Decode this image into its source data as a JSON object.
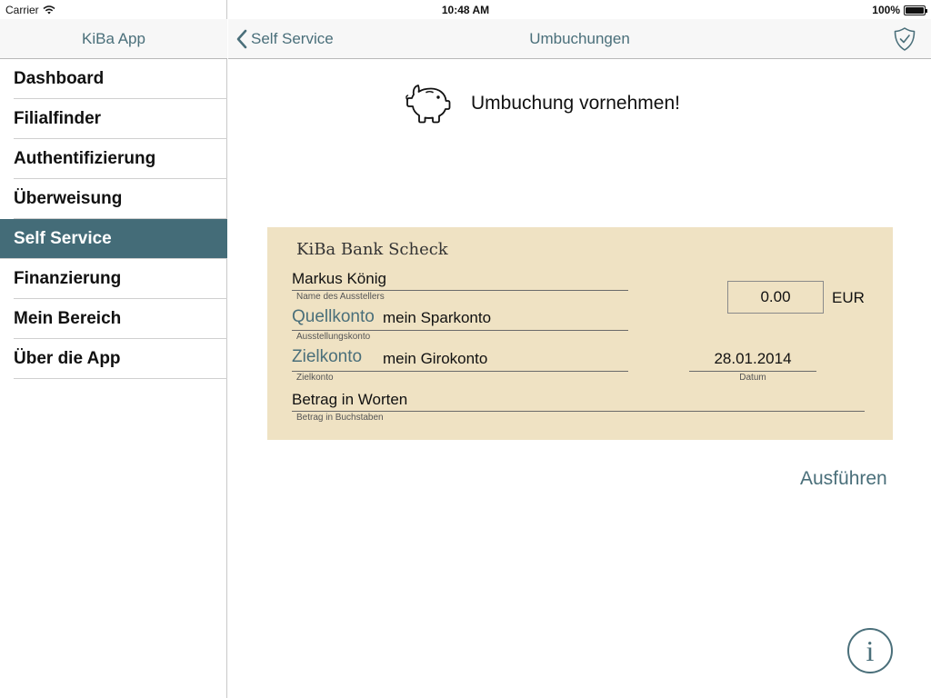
{
  "status_bar": {
    "carrier": "Carrier",
    "time": "10:48 AM",
    "battery": "100%",
    "battery_level": 1.0,
    "wifi_icon": "wifi-icon"
  },
  "sidebar": {
    "title": "KiBa App",
    "items": [
      {
        "label": "Dashboard"
      },
      {
        "label": "Filialfinder"
      },
      {
        "label": "Authentifizierung"
      },
      {
        "label": "Überweisung"
      },
      {
        "label": "Self Service",
        "active": true
      },
      {
        "label": "Finanzierung"
      },
      {
        "label": "Mein Bereich"
      },
      {
        "label": "Über die App"
      }
    ]
  },
  "header": {
    "back_label": "Self Service",
    "title": "Umbuchungen",
    "right_icon": "shield-check-icon"
  },
  "main": {
    "heading": "Umbuchung vornehmen!",
    "heading_icon": "piggy-bank-icon",
    "execute_label": "Ausführen",
    "info_label": "i"
  },
  "cheque": {
    "brand": "KiBa Bank Scheck",
    "issuer_name": "Markus König",
    "issuer_caption": "Name des Ausstellers",
    "source_label": "Quellkonto",
    "source_value": "mein Sparkonto",
    "source_caption": "Ausstellungskonto",
    "target_label": "Zielkonto",
    "target_value": "mein Girokonto",
    "target_caption": "Zielkonto",
    "amount": "0.00",
    "currency": "EUR",
    "date": "28.01.2014",
    "date_caption": "Datum",
    "amount_words": "Betrag in Worten",
    "amount_words_caption": "Betrag in Buchstaben"
  },
  "colors": {
    "accent": "#4a6f7a",
    "active_row": "#446c78",
    "cheque_bg": "#efe2c3"
  }
}
